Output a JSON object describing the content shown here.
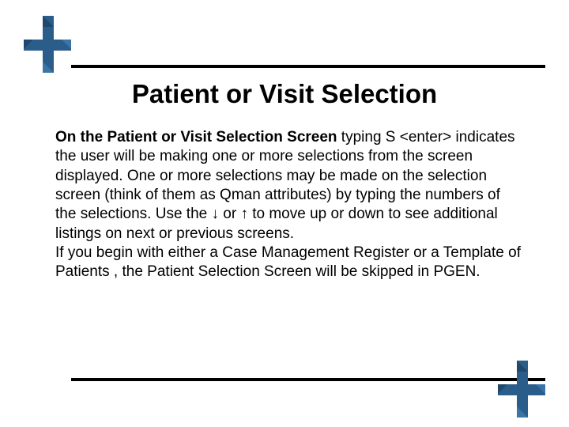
{
  "colors": {
    "brand": "#2b5d8b",
    "white": "#ffffff",
    "black": "#000000"
  },
  "title": "Patient or Visit Selection",
  "body": {
    "bold_lead": "On the Patient or Visit Selection Screen",
    "p1_rest": " typing S <enter> indicates the user will be making one or more selections from the screen displayed.  One or more selections may be made on the selection screen (think of them as Qman attributes) by typing the numbers of the selections. Use the ↓ or ↑ to move up or down to see additional listings on next or previous screens.",
    "p2": "If you begin with either a Case Management Register or a Template of Patients , the Patient Selection Screen will be skipped in PGEN."
  }
}
